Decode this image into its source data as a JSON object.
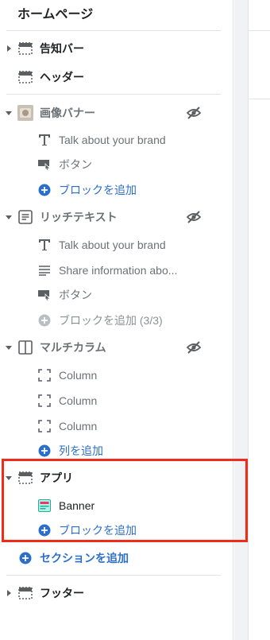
{
  "page_title": "ホームページ",
  "sections": {
    "announcement": {
      "label": "告知バー"
    },
    "header": {
      "label": "ヘッダー"
    },
    "image_banner": {
      "label": "画像バナー",
      "blocks": [
        "Talk about your brand",
        "ボタン"
      ],
      "add_block": "ブロックを追加"
    },
    "rich_text": {
      "label": "リッチテキスト",
      "blocks": [
        "Talk about your brand",
        "Share information abo...",
        "ボタン"
      ],
      "add_block": "ブロックを追加 (3/3)"
    },
    "multicolumn": {
      "label": "マルチカラム",
      "blocks": [
        "Column",
        "Column",
        "Column"
      ],
      "add_block": "列を追加"
    },
    "apps": {
      "label": "アプリ",
      "blocks": [
        "Banner"
      ],
      "add_block": "ブロックを追加"
    },
    "add_section": "セクションを追加",
    "footer": {
      "label": "フッター"
    }
  },
  "colors": {
    "accent_blue": "#2c6ecb",
    "highlight_red": "#ef2b1a"
  }
}
